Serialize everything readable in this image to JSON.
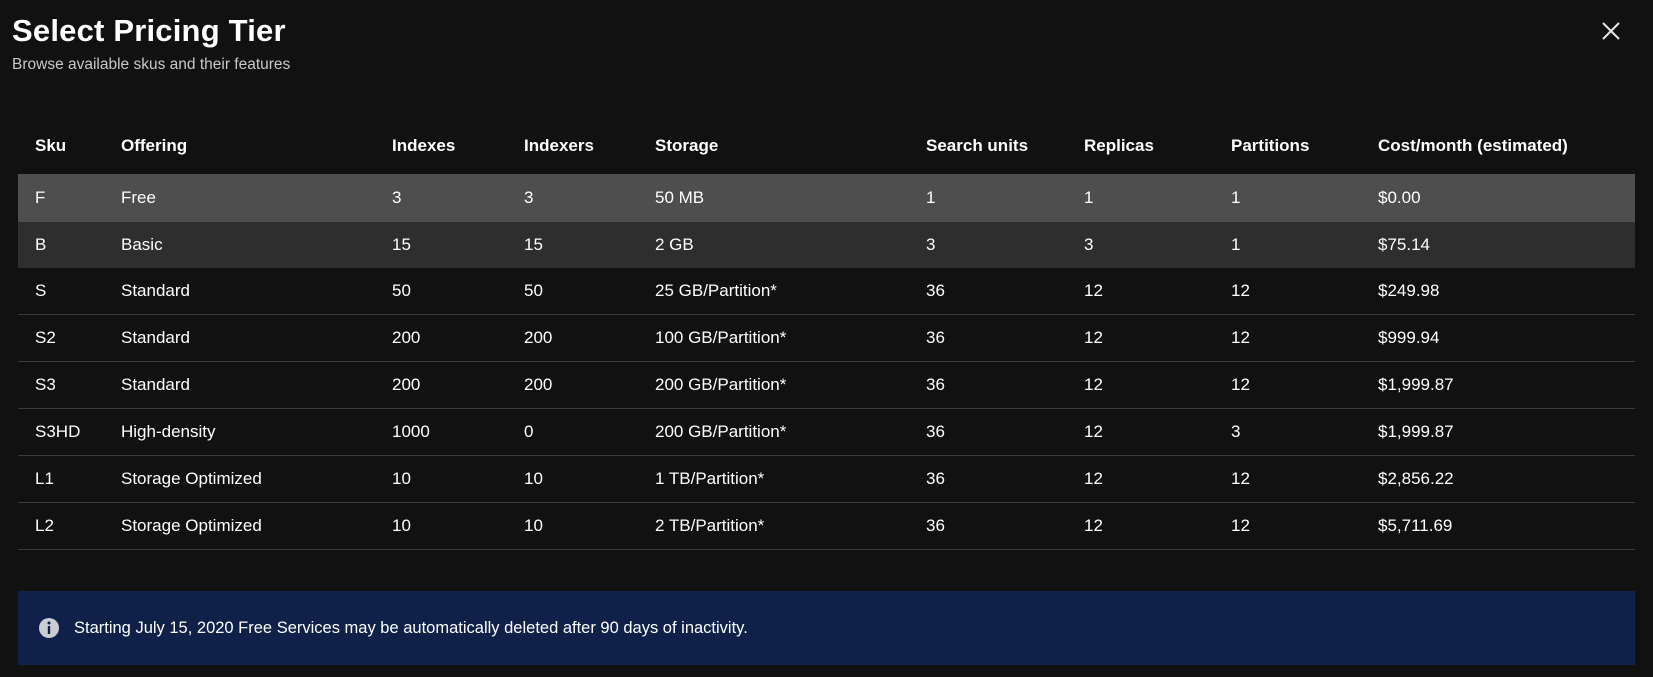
{
  "dialog": {
    "title": "Select Pricing Tier",
    "subtitle": "Browse available skus and their features",
    "close_icon": "close-icon"
  },
  "table": {
    "columns": [
      "Sku",
      "Offering",
      "Indexes",
      "Indexers",
      "Storage",
      "Search units",
      "Replicas",
      "Partitions",
      "Cost/month (estimated)"
    ],
    "rows": [
      {
        "sku": "F",
        "offering": "Free",
        "indexes": "3",
        "indexers": "3",
        "storage": "50 MB",
        "search_units": "1",
        "replicas": "1",
        "partitions": "1",
        "cost": "$0.00"
      },
      {
        "sku": "B",
        "offering": "Basic",
        "indexes": "15",
        "indexers": "15",
        "storage": "2 GB",
        "search_units": "3",
        "replicas": "3",
        "partitions": "1",
        "cost": "$75.14"
      },
      {
        "sku": "S",
        "offering": "Standard",
        "indexes": "50",
        "indexers": "50",
        "storage": "25 GB/Partition*",
        "search_units": "36",
        "replicas": "12",
        "partitions": "12",
        "cost": "$249.98"
      },
      {
        "sku": "S2",
        "offering": "Standard",
        "indexes": "200",
        "indexers": "200",
        "storage": "100 GB/Partition*",
        "search_units": "36",
        "replicas": "12",
        "partitions": "12",
        "cost": "$999.94"
      },
      {
        "sku": "S3",
        "offering": "Standard",
        "indexes": "200",
        "indexers": "200",
        "storage": "200 GB/Partition*",
        "search_units": "36",
        "replicas": "12",
        "partitions": "12",
        "cost": "$1,999.87"
      },
      {
        "sku": "S3HD",
        "offering": "High-density",
        "indexes": "1000",
        "indexers": "0",
        "storage": "200 GB/Partition*",
        "search_units": "36",
        "replicas": "12",
        "partitions": "3",
        "cost": "$1,999.87"
      },
      {
        "sku": "L1",
        "offering": "Storage Optimized",
        "indexes": "10",
        "indexers": "10",
        "storage": "1 TB/Partition*",
        "search_units": "36",
        "replicas": "12",
        "partitions": "12",
        "cost": "$2,856.22"
      },
      {
        "sku": "L2",
        "offering": "Storage Optimized",
        "indexes": "10",
        "indexers": "10",
        "storage": "2 TB/Partition*",
        "search_units": "36",
        "replicas": "12",
        "partitions": "12",
        "cost": "$5,711.69"
      }
    ]
  },
  "notice": {
    "icon": "info-icon",
    "text": "Starting July 15, 2020 Free Services may be automatically deleted after 90 days of inactivity."
  },
  "colors": {
    "background": "#111111",
    "selected_row": "#4e4e4e",
    "hover_row": "#2e2e2e",
    "row_divider": "#3a3a3a",
    "notice_background": "#0f2149"
  }
}
